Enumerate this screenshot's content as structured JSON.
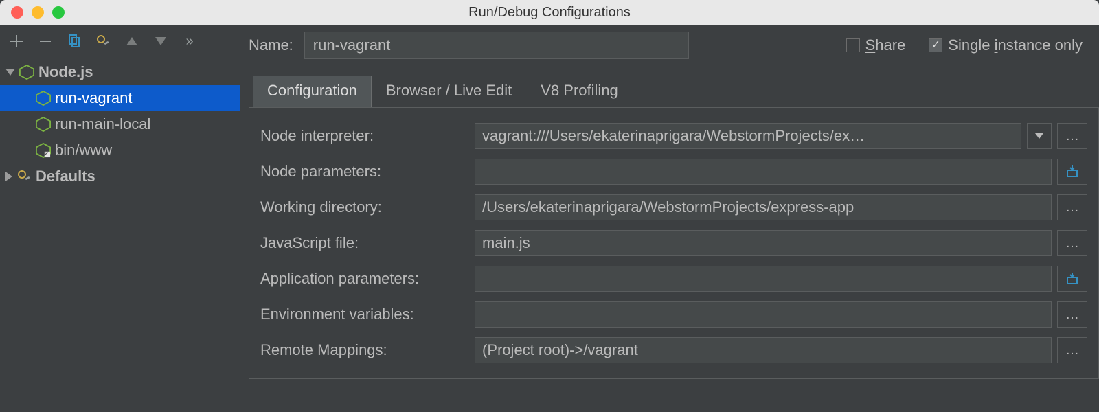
{
  "window": {
    "title": "Run/Debug Configurations"
  },
  "sidebar": {
    "groups": [
      {
        "label": "Node.js",
        "expanded": true,
        "icon": "nodejs-icon",
        "items": [
          {
            "label": "run-vagrant",
            "selected": true
          },
          {
            "label": "run-main-local",
            "selected": false
          },
          {
            "label": "bin/www",
            "selected": false
          }
        ]
      },
      {
        "label": "Defaults",
        "expanded": false,
        "icon": "gear-wrench-icon"
      }
    ]
  },
  "header": {
    "name_label": "Name:",
    "name_value": "run-vagrant",
    "share_label": "Share",
    "share_checked": false,
    "single_instance_label": "Single instance only",
    "single_instance_checked": true
  },
  "tabs": [
    {
      "label": "Configuration",
      "active": true
    },
    {
      "label": "Browser / Live Edit",
      "active": false
    },
    {
      "label": "V8 Profiling",
      "active": false
    }
  ],
  "form": {
    "node_interpreter_label": "Node interpreter:",
    "node_interpreter_value": "vagrant:///Users/ekaterinaprigara/WebstormProjects/ex…",
    "node_parameters_label": "Node parameters:",
    "node_parameters_value": "",
    "working_dir_label": "Working directory:",
    "working_dir_value": "/Users/ekaterinaprigara/WebstormProjects/express-app",
    "js_file_label": "JavaScript file:",
    "js_file_value": "main.js",
    "app_params_label": "Application parameters:",
    "app_params_value": "",
    "env_vars_label": "Environment variables:",
    "env_vars_value": "",
    "remote_mappings_label": "Remote Mappings:",
    "remote_mappings_value": "(Project root)->/vagrant"
  }
}
